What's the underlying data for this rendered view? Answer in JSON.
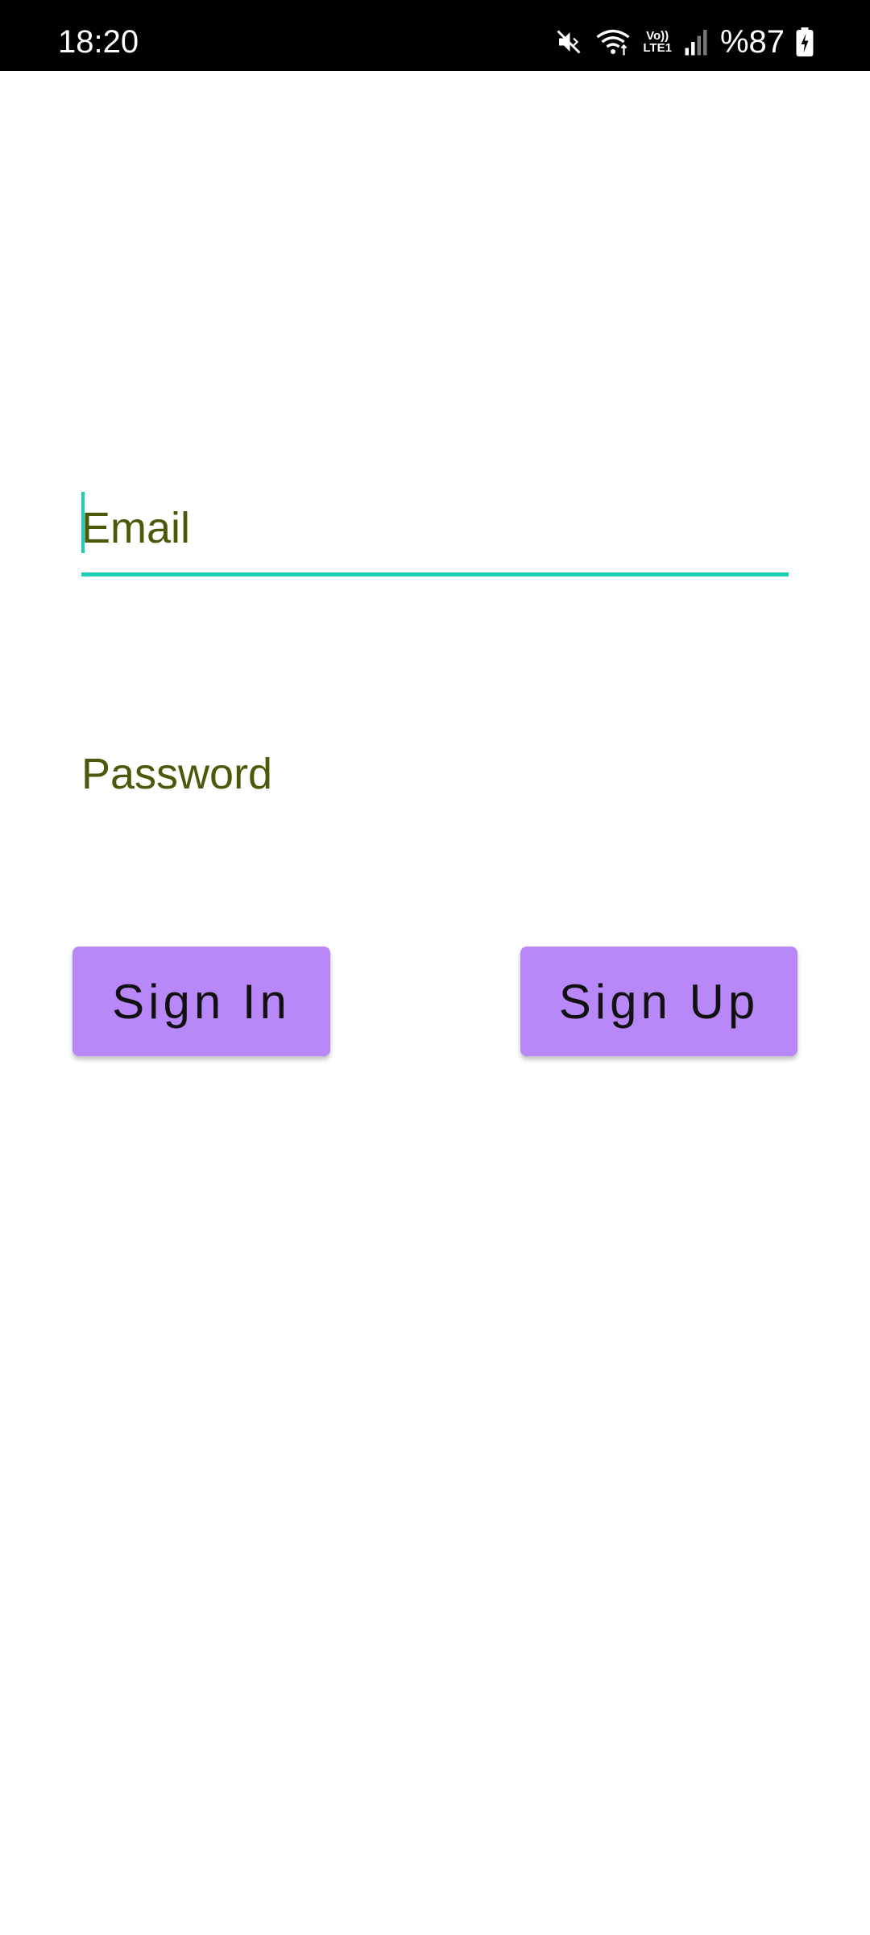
{
  "status_bar": {
    "time": "18:20",
    "network_label_top": "Vo))",
    "network_label_bottom": "LTE1",
    "battery_percent": "%87",
    "icons": [
      "mute-icon",
      "wifi-icon",
      "volte-lte-icon",
      "signal-icon",
      "battery-charging-icon"
    ]
  },
  "form": {
    "email_placeholder": "Email",
    "email_value": "",
    "password_placeholder": "Password",
    "password_value": "",
    "signin_label": "Sign In",
    "signup_label": "Sign Up"
  },
  "colors": {
    "accent": "#1ccfb7",
    "hint_text": "#4a5a0a",
    "button_bg": "#b888f8",
    "status_bar_bg": "#000000"
  }
}
